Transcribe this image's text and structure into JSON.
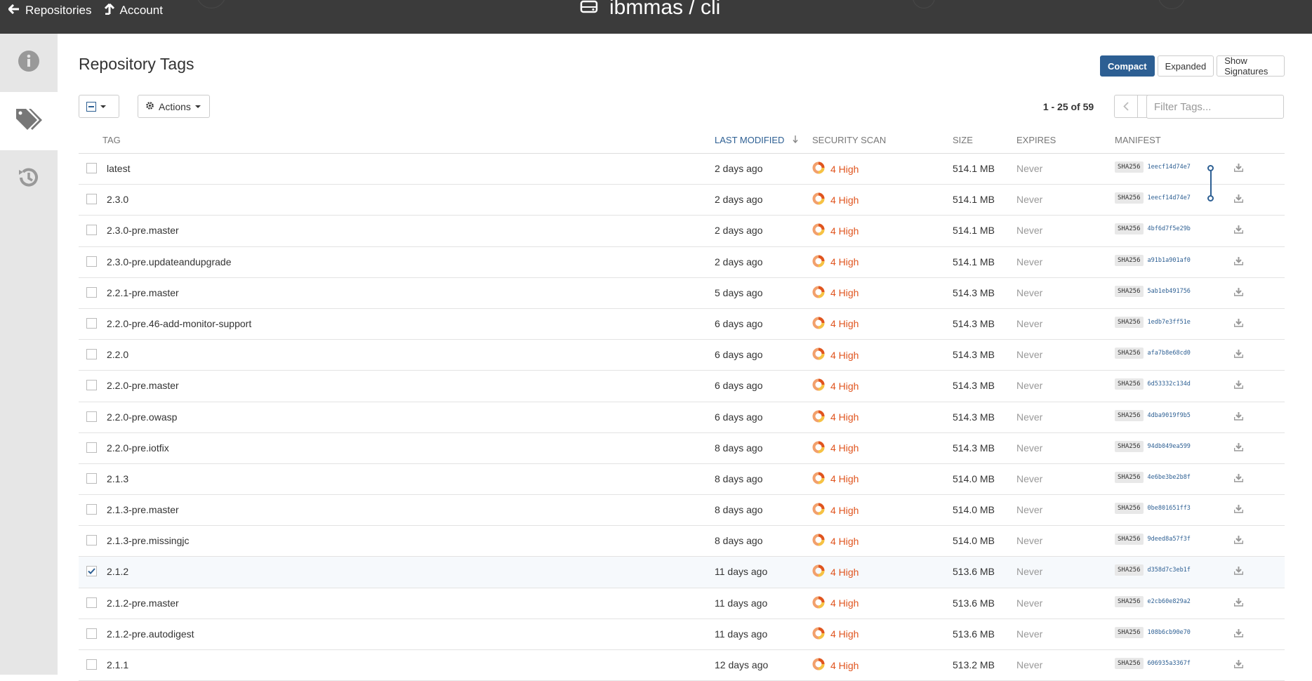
{
  "topbar": {
    "repositories_label": "Repositories",
    "account_label": "Account",
    "repo_title": "ibmmas / cli"
  },
  "sidebar": {
    "tabs": [
      {
        "icon": "info-icon",
        "active": false
      },
      {
        "icon": "tags-icon",
        "active": true
      },
      {
        "icon": "history-icon",
        "active": false
      }
    ]
  },
  "main": {
    "heading": "Repository Tags",
    "view_buttons": {
      "compact": "Compact",
      "expanded": "Expanded",
      "signatures": "Show Signatures"
    },
    "actions_label": "Actions",
    "paging": "1 - 25 of 59",
    "filter_placeholder": "Filter Tags..."
  },
  "table": {
    "headers": {
      "tag": "TAG",
      "last_modified": "LAST MODIFIED",
      "security_scan": "SECURITY SCAN",
      "size": "SIZE",
      "expires": "EXPIRES",
      "manifest": "MANIFEST"
    },
    "rows": [
      {
        "tag": "latest",
        "modified": "2 days ago",
        "scan": "4 High",
        "size": "514.1 MB",
        "expires": "Never",
        "sha": "SHA256",
        "digest": "1eecf14d74e7",
        "checked": false
      },
      {
        "tag": "2.3.0",
        "modified": "2 days ago",
        "scan": "4 High",
        "size": "514.1 MB",
        "expires": "Never",
        "sha": "SHA256",
        "digest": "1eecf14d74e7",
        "checked": false
      },
      {
        "tag": "2.3.0-pre.master",
        "modified": "2 days ago",
        "scan": "4 High",
        "size": "514.1 MB",
        "expires": "Never",
        "sha": "SHA256",
        "digest": "4bf6d7f5e29b",
        "checked": false
      },
      {
        "tag": "2.3.0-pre.updateandupgrade",
        "modified": "2 days ago",
        "scan": "4 High",
        "size": "514.1 MB",
        "expires": "Never",
        "sha": "SHA256",
        "digest": "a91b1a901af0",
        "checked": false
      },
      {
        "tag": "2.2.1-pre.master",
        "modified": "5 days ago",
        "scan": "4 High",
        "size": "514.3 MB",
        "expires": "Never",
        "sha": "SHA256",
        "digest": "5ab1eb491756",
        "checked": false
      },
      {
        "tag": "2.2.0-pre.46-add-monitor-support",
        "modified": "6 days ago",
        "scan": "4 High",
        "size": "514.3 MB",
        "expires": "Never",
        "sha": "SHA256",
        "digest": "1edb7e3ff51e",
        "checked": false
      },
      {
        "tag": "2.2.0",
        "modified": "6 days ago",
        "scan": "4 High",
        "size": "514.3 MB",
        "expires": "Never",
        "sha": "SHA256",
        "digest": "afa7b8e68cd0",
        "checked": false
      },
      {
        "tag": "2.2.0-pre.master",
        "modified": "6 days ago",
        "scan": "4 High",
        "size": "514.3 MB",
        "expires": "Never",
        "sha": "SHA256",
        "digest": "6d53332c134d",
        "checked": false
      },
      {
        "tag": "2.2.0-pre.owasp",
        "modified": "6 days ago",
        "scan": "4 High",
        "size": "514.3 MB",
        "expires": "Never",
        "sha": "SHA256",
        "digest": "4dba9019f9b5",
        "checked": false
      },
      {
        "tag": "2.2.0-pre.iotfix",
        "modified": "8 days ago",
        "scan": "4 High",
        "size": "514.3 MB",
        "expires": "Never",
        "sha": "SHA256",
        "digest": "94db049ea599",
        "checked": false
      },
      {
        "tag": "2.1.3",
        "modified": "8 days ago",
        "scan": "4 High",
        "size": "514.0 MB",
        "expires": "Never",
        "sha": "SHA256",
        "digest": "4e6be3be2b8f",
        "checked": false
      },
      {
        "tag": "2.1.3-pre.master",
        "modified": "8 days ago",
        "scan": "4 High",
        "size": "514.0 MB",
        "expires": "Never",
        "sha": "SHA256",
        "digest": "0be801651ff3",
        "checked": false
      },
      {
        "tag": "2.1.3-pre.missingjc",
        "modified": "8 days ago",
        "scan": "4 High",
        "size": "514.0 MB",
        "expires": "Never",
        "sha": "SHA256",
        "digest": "9deed8a57f3f",
        "checked": false
      },
      {
        "tag": "2.1.2",
        "modified": "11 days ago",
        "scan": "4 High",
        "size": "513.6 MB",
        "expires": "Never",
        "sha": "SHA256",
        "digest": "d358d7c3eb1f",
        "checked": true
      },
      {
        "tag": "2.1.2-pre.master",
        "modified": "11 days ago",
        "scan": "4 High",
        "size": "513.6 MB",
        "expires": "Never",
        "sha": "SHA256",
        "digest": "e2cb60e829a2",
        "checked": false
      },
      {
        "tag": "2.1.2-pre.autodigest",
        "modified": "11 days ago",
        "scan": "4 High",
        "size": "513.6 MB",
        "expires": "Never",
        "sha": "SHA256",
        "digest": "108b6cb90e70",
        "checked": false
      },
      {
        "tag": "2.1.1",
        "modified": "12 days ago",
        "scan": "4 High",
        "size": "513.2 MB",
        "expires": "Never",
        "sha": "SHA256",
        "digest": "606935a3367f",
        "checked": false
      }
    ]
  },
  "colors": {
    "accent": "#2d5f93",
    "scan_high": "#e0541e",
    "topbar": "#3b3b3b"
  }
}
